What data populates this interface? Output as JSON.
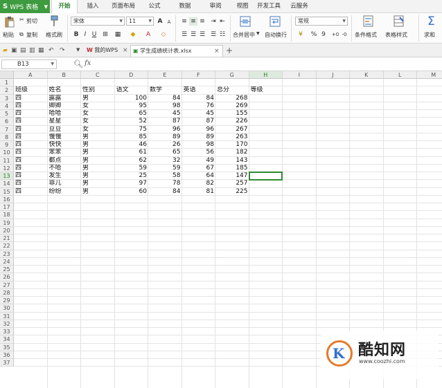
{
  "app": {
    "name": "WPS 表格",
    "logo_letter": "S"
  },
  "menu": {
    "items": [
      "开始",
      "插入",
      "页面布局",
      "公式",
      "数据",
      "审阅",
      "视图",
      "开发工具",
      "云服务"
    ],
    "active": "开始"
  },
  "ribbon": {
    "paste": "粘贴",
    "cut": "剪切",
    "copy": "复制",
    "format_painter": "格式刷",
    "font_name": "宋体",
    "font_size": "11",
    "merge_center": "合并居中",
    "wrap_text": "自动换行",
    "number_format": "常规",
    "conditional_format": "条件格式",
    "table_style": "表格样式",
    "sum": "求和",
    "bold": "B",
    "italic": "I",
    "underline": "U",
    "grow_font": "A",
    "shrink_font": "A",
    "font_color": "A",
    "percent": "%",
    "thousands": "9"
  },
  "tabs": {
    "my_wps": "我的WPS",
    "file": "学生成绩统计表.xlsx"
  },
  "formula_bar": {
    "cell_ref": "B13",
    "fx": "fx",
    "value": ""
  },
  "columns": [
    "A",
    "B",
    "C",
    "D",
    "E",
    "F",
    "G",
    "H",
    "I",
    "J",
    "K",
    "L",
    "M"
  ],
  "selected_column": "H",
  "selected_row": 13,
  "row_count": 37,
  "header_row": [
    "班级",
    "姓名",
    "性别",
    "语文",
    "数学",
    "英语",
    "总分",
    "等级"
  ],
  "rows": [
    [
      "四",
      "露露",
      "男",
      100,
      84,
      84,
      268
    ],
    [
      "四",
      "卿卿",
      "女",
      95,
      98,
      76,
      269
    ],
    [
      "四",
      "哈哈",
      "女",
      65,
      45,
      45,
      155
    ],
    [
      "四",
      "星星",
      "女",
      52,
      87,
      87,
      226
    ],
    [
      "四",
      "豆豆",
      "女",
      75,
      96,
      96,
      267
    ],
    [
      "四",
      "慢慢",
      "男",
      85,
      89,
      89,
      263
    ],
    [
      "四",
      "快快",
      "男",
      46,
      26,
      98,
      170
    ],
    [
      "四",
      "笨笨",
      "男",
      61,
      65,
      56,
      182
    ],
    [
      "四",
      "都点",
      "男",
      62,
      32,
      49,
      143
    ],
    [
      "四",
      "不哈",
      "男",
      59,
      59,
      67,
      185
    ],
    [
      "四",
      "发生",
      "男",
      25,
      58,
      64,
      147
    ],
    [
      "四",
      "菲儿",
      "男",
      97,
      78,
      82,
      257
    ],
    [
      "四",
      "纷纷",
      "男",
      60,
      84,
      81,
      225
    ]
  ],
  "watermark": {
    "logo_letter": "K",
    "title": "酷知网",
    "url": "www.coozhi.com"
  },
  "colors": {
    "accent": "#3f9b3f",
    "active_cell": "#2f8a2f",
    "watermark_ring": "#e6792b",
    "watermark_letter": "#2f6fd0"
  }
}
